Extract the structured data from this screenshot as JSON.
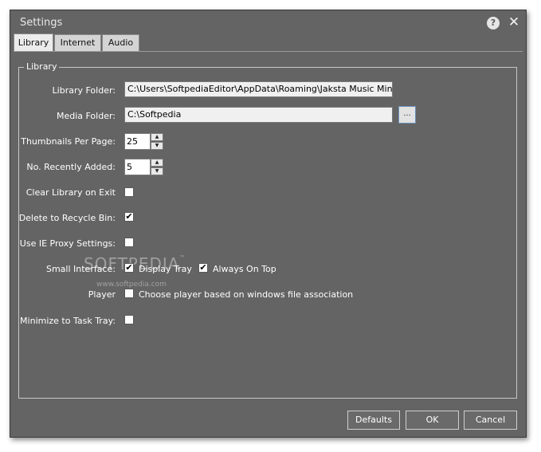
{
  "window": {
    "title": "Settings"
  },
  "titlebar": {
    "help_glyph": "?",
    "close_glyph": "✕"
  },
  "tabs": [
    {
      "label": "Library",
      "active": true
    },
    {
      "label": "Internet",
      "active": false
    },
    {
      "label": "Audio",
      "active": false
    }
  ],
  "library": {
    "group_title": "Library",
    "library_folder": {
      "label": "Library Folder:",
      "value": "C:\\Users\\SoftpediaEditor\\AppData\\Roaming\\Jaksta Music Miner\\"
    },
    "media_folder": {
      "label": "Media Folder:",
      "value": "C:\\Softpedia",
      "browse_label": "..."
    },
    "thumbnails_per_page": {
      "label": "Thumbnails Per Page:",
      "value": "25"
    },
    "recently_added": {
      "label": "No. Recently Added:",
      "value": "5"
    },
    "clear_on_exit": {
      "label": "Clear Library on Exit",
      "checked": false
    },
    "delete_to_recycle": {
      "label": "Delete to Recycle Bin:",
      "checked": true,
      "mark": "✔"
    },
    "ie_proxy": {
      "label": "Use IE Proxy Settings:",
      "checked": false
    },
    "small_interface": {
      "label": "Small Interface:",
      "display_tray": {
        "label": "Display Tray",
        "checked": true,
        "mark": "✔"
      },
      "always_on_top": {
        "label": "Always On Top",
        "checked": true,
        "mark": "✔"
      }
    },
    "player": {
      "label": "Player",
      "option_label": "Choose player based on windows file association",
      "checked": false
    },
    "minimize_to_tray": {
      "label": "Minimize to Task Tray:",
      "checked": false
    }
  },
  "watermark": {
    "brand": "SOFTPEDIA",
    "tm": "™",
    "url": "www.softpedia.com"
  },
  "buttons": {
    "defaults": "Defaults",
    "ok": "OK",
    "cancel": "Cancel"
  },
  "spin_glyphs": {
    "up": "▲",
    "down": "▼"
  }
}
